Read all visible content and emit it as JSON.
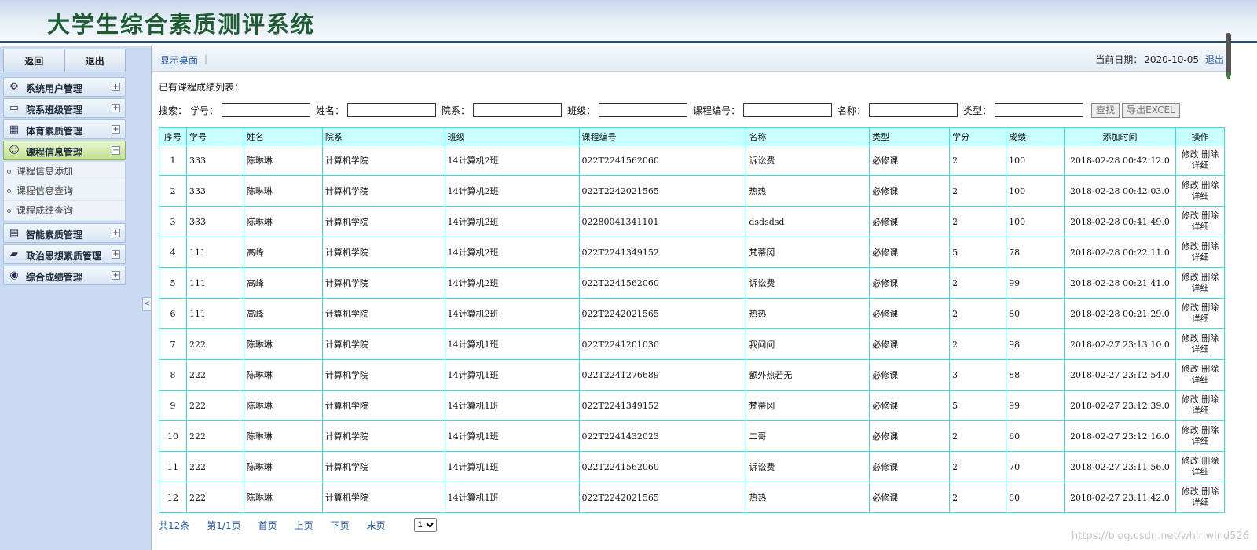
{
  "app": {
    "title": "大学生综合素质测评系统"
  },
  "sidebar": {
    "buttons": {
      "back": "返回",
      "exit": "退出"
    },
    "menus": [
      {
        "label": "系统用户管理",
        "icon": "gear-icon",
        "glyph": "⚙",
        "toggle": "+"
      },
      {
        "label": "院系班级管理",
        "icon": "monitor-icon",
        "glyph": "▭",
        "toggle": "+"
      },
      {
        "label": "体育素质管理",
        "icon": "calendar-icon",
        "glyph": "▦",
        "toggle": "+"
      },
      {
        "label": "课程信息管理",
        "icon": "user-icon",
        "glyph": "☺",
        "toggle": "−"
      },
      {
        "label": "智能素质管理",
        "icon": "book-icon",
        "glyph": "▤",
        "toggle": "+"
      },
      {
        "label": "政治思想素质管理",
        "icon": "folder-icon",
        "glyph": "▰",
        "toggle": "+"
      },
      {
        "label": "综合成绩管理",
        "icon": "coins-icon",
        "glyph": "◉",
        "toggle": "+"
      }
    ],
    "submenu": [
      "课程信息添加",
      "课程信息查询",
      "课程成绩查询"
    ],
    "collapse": "<"
  },
  "topbar": {
    "home_link": "显示桌面",
    "sep": "|",
    "date_label": "当前日期：",
    "date_value": "2020-10-05",
    "logout": "退出"
  },
  "main": {
    "list_title": "已有课程成绩列表：",
    "search": {
      "prefix": "搜索：",
      "student_no": "学号：",
      "name": "姓名：",
      "department": "院系：",
      "class": "班级：",
      "course_no": "课程编号：",
      "course_name": "名称：",
      "type": "类型：",
      "find_button": "查找",
      "export_button": "导出EXCEL"
    },
    "table": {
      "headers": [
        "序号",
        "学号",
        "姓名",
        "院系",
        "班级",
        "课程编号",
        "名称",
        "类型",
        "学分",
        "成绩",
        "添加时间",
        "操作"
      ],
      "ops": {
        "edit": "修改",
        "delete": "删除",
        "detail": "详细"
      },
      "rows": [
        [
          "1",
          "333",
          "陈琳琳",
          "计算机学院",
          "14计算机2班",
          "022T2241562060",
          "诉讼费",
          "必修课",
          "2",
          "100",
          "2018-02-28 00:42:12.0"
        ],
        [
          "2",
          "333",
          "陈琳琳",
          "计算机学院",
          "14计算机2班",
          "022T2242021565",
          "热热",
          "必修课",
          "2",
          "100",
          "2018-02-28 00:42:03.0"
        ],
        [
          "3",
          "333",
          "陈琳琳",
          "计算机学院",
          "14计算机2班",
          "02280041341101",
          "dsdsdsd",
          "必修课",
          "2",
          "100",
          "2018-02-28 00:41:49.0"
        ],
        [
          "4",
          "111",
          "高峰",
          "计算机学院",
          "14计算机2班",
          "022T2241349152",
          "梵蒂冈",
          "必修课",
          "5",
          "78",
          "2018-02-28 00:22:11.0"
        ],
        [
          "5",
          "111",
          "高峰",
          "计算机学院",
          "14计算机2班",
          "022T2241562060",
          "诉讼费",
          "必修课",
          "2",
          "99",
          "2018-02-28 00:21:41.0"
        ],
        [
          "6",
          "111",
          "高峰",
          "计算机学院",
          "14计算机2班",
          "022T2242021565",
          "热热",
          "必修课",
          "2",
          "80",
          "2018-02-28 00:21:29.0"
        ],
        [
          "7",
          "222",
          "陈琳琳",
          "计算机学院",
          "14计算机1班",
          "022T2241201030",
          "我问问",
          "必修课",
          "2",
          "98",
          "2018-02-27 23:13:10.0"
        ],
        [
          "8",
          "222",
          "陈琳琳",
          "计算机学院",
          "14计算机1班",
          "022T2241276689",
          "额外热若无",
          "必修课",
          "3",
          "88",
          "2018-02-27 23:12:54.0"
        ],
        [
          "9",
          "222",
          "陈琳琳",
          "计算机学院",
          "14计算机1班",
          "022T2241349152",
          "梵蒂冈",
          "必修课",
          "5",
          "99",
          "2018-02-27 23:12:39.0"
        ],
        [
          "10",
          "222",
          "陈琳琳",
          "计算机学院",
          "14计算机1班",
          "022T2241432023",
          "二哥",
          "必修课",
          "2",
          "60",
          "2018-02-27 23:12:16.0"
        ],
        [
          "11",
          "222",
          "陈琳琳",
          "计算机学院",
          "14计算机1班",
          "022T2241562060",
          "诉讼费",
          "必修课",
          "2",
          "70",
          "2018-02-27 23:11:56.0"
        ],
        [
          "12",
          "222",
          "陈琳琳",
          "计算机学院",
          "14计算机1班",
          "022T2242021565",
          "热热",
          "必修课",
          "2",
          "80",
          "2018-02-27 23:11:42.0"
        ]
      ]
    },
    "pager": {
      "total": "共12条",
      "page_info": "第1/1页",
      "first": "首页",
      "prev": "上页",
      "next": "下页",
      "last": "末页",
      "select_value": "1"
    }
  },
  "watermark": "https://blog.csdn.net/whirlwind526"
}
